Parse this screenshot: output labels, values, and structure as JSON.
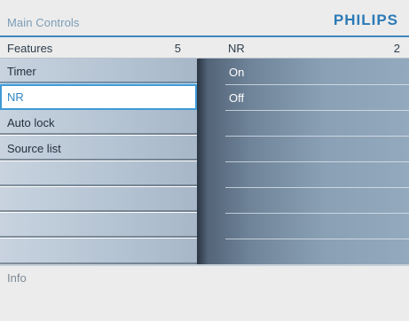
{
  "header": {
    "title": "Main Controls",
    "brand": "PHILIPS"
  },
  "left_column": {
    "label": "Features",
    "count": "5",
    "items": [
      {
        "label": "Timer",
        "selected": false
      },
      {
        "label": "NR",
        "selected": true
      },
      {
        "label": "Auto lock",
        "selected": false
      },
      {
        "label": "Source list",
        "selected": false
      },
      {
        "label": "",
        "selected": false
      },
      {
        "label": "",
        "selected": false
      },
      {
        "label": "",
        "selected": false
      },
      {
        "label": "",
        "selected": false
      }
    ]
  },
  "right_column": {
    "label": "NR",
    "count": "2",
    "options": [
      {
        "label": "On"
      },
      {
        "label": "Off"
      }
    ]
  },
  "footer": {
    "info": "Info"
  },
  "colors": {
    "brand": "#2c7ab6",
    "accent": "#3f9ad6",
    "title": "#7a9cb6"
  }
}
